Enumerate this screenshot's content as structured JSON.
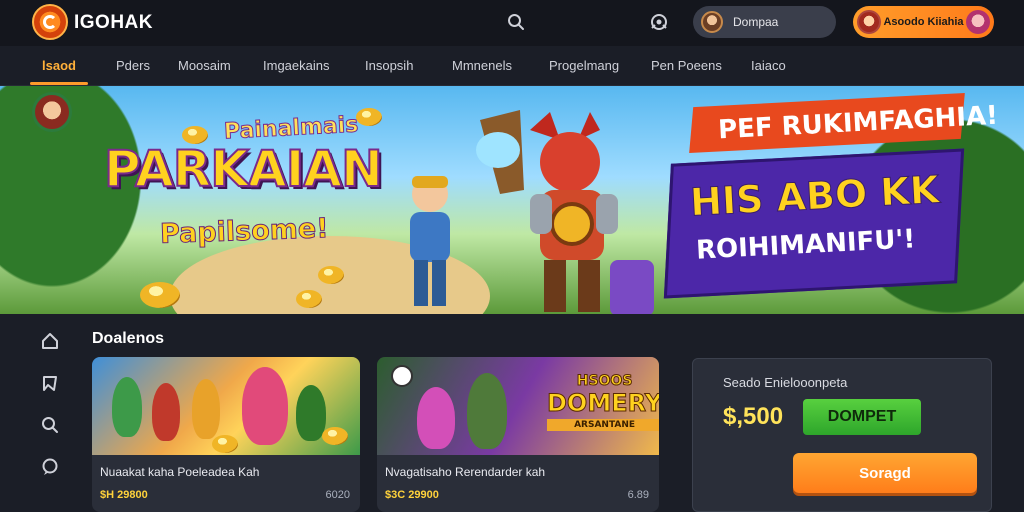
{
  "brand": {
    "name": "IGOHAK"
  },
  "header": {
    "user_label": "Dompaa",
    "promo_label": "Asoodo Kiiahia"
  },
  "nav": {
    "items": [
      {
        "label": "lsaod",
        "active": true
      },
      {
        "label": "Pders"
      },
      {
        "label": "Moosaim"
      },
      {
        "label": "Imgaekains"
      },
      {
        "label": "Insopsih"
      },
      {
        "label": "Mmnenels"
      },
      {
        "label": "Progelmang"
      },
      {
        "label": "Pen Poeens"
      },
      {
        "label": "Iaiaco"
      }
    ]
  },
  "hero": {
    "kicker": "Painalmais",
    "title": "PARKAIAN",
    "subtitle": "Papilsome!",
    "banner_red": "PEF RUKIMFAGHIA!",
    "banner_line1": "HIS ABO KK",
    "banner_line2": "ROIHIMANIFU'!"
  },
  "section": {
    "title": "Doalenos"
  },
  "cards": [
    {
      "name": "Nuaakat kaha Poeleadea Kah",
      "price": "$H 29800",
      "meta": "6020"
    },
    {
      "name": "Nvagatisaho Rerendarder kah",
      "price": "$3C 29900",
      "meta": "6.89",
      "label": {
        "l1": "HSOOS",
        "l2": "DOMERY",
        "l3": "ARSANTANE"
      }
    }
  ],
  "panel": {
    "title": "Seado Enielooonpeta",
    "amount": "$,500",
    "tag_label": "DOMPET",
    "cta_label": "Soragd"
  },
  "colors": {
    "accent": "#ff9a2b",
    "background": "#1b1e27",
    "panel": "#2a2e39",
    "cta": "#ff8c1f",
    "tag": "#3bb831",
    "price": "#ffd23b"
  },
  "icons": [
    "logo-icon",
    "search-icon",
    "gamepad-icon",
    "home-icon",
    "cards-icon",
    "search-icon",
    "chat-icon"
  ]
}
